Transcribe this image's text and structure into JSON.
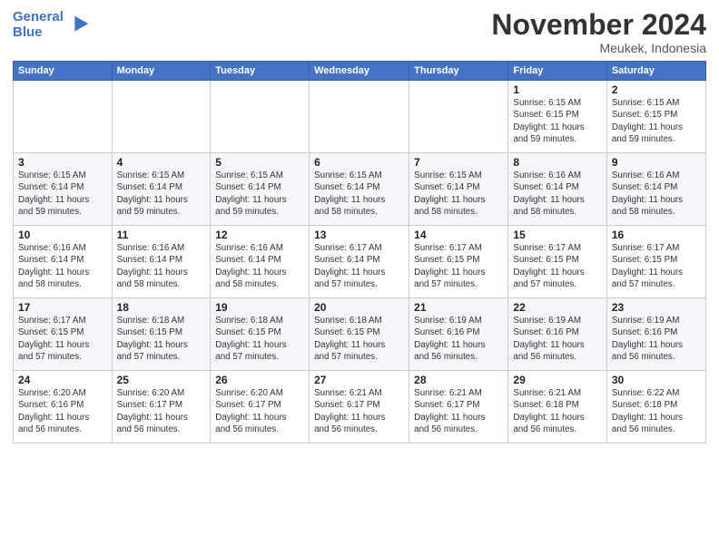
{
  "header": {
    "logo_line1": "General",
    "logo_line2": "Blue",
    "month": "November 2024",
    "location": "Meukek, Indonesia"
  },
  "weekdays": [
    "Sunday",
    "Monday",
    "Tuesday",
    "Wednesday",
    "Thursday",
    "Friday",
    "Saturday"
  ],
  "weeks": [
    [
      {
        "day": "",
        "info": ""
      },
      {
        "day": "",
        "info": ""
      },
      {
        "day": "",
        "info": ""
      },
      {
        "day": "",
        "info": ""
      },
      {
        "day": "",
        "info": ""
      },
      {
        "day": "1",
        "info": "Sunrise: 6:15 AM\nSunset: 6:15 PM\nDaylight: 11 hours\nand 59 minutes."
      },
      {
        "day": "2",
        "info": "Sunrise: 6:15 AM\nSunset: 6:15 PM\nDaylight: 11 hours\nand 59 minutes."
      }
    ],
    [
      {
        "day": "3",
        "info": "Sunrise: 6:15 AM\nSunset: 6:14 PM\nDaylight: 11 hours\nand 59 minutes."
      },
      {
        "day": "4",
        "info": "Sunrise: 6:15 AM\nSunset: 6:14 PM\nDaylight: 11 hours\nand 59 minutes."
      },
      {
        "day": "5",
        "info": "Sunrise: 6:15 AM\nSunset: 6:14 PM\nDaylight: 11 hours\nand 59 minutes."
      },
      {
        "day": "6",
        "info": "Sunrise: 6:15 AM\nSunset: 6:14 PM\nDaylight: 11 hours\nand 58 minutes."
      },
      {
        "day": "7",
        "info": "Sunrise: 6:15 AM\nSunset: 6:14 PM\nDaylight: 11 hours\nand 58 minutes."
      },
      {
        "day": "8",
        "info": "Sunrise: 6:16 AM\nSunset: 6:14 PM\nDaylight: 11 hours\nand 58 minutes."
      },
      {
        "day": "9",
        "info": "Sunrise: 6:16 AM\nSunset: 6:14 PM\nDaylight: 11 hours\nand 58 minutes."
      }
    ],
    [
      {
        "day": "10",
        "info": "Sunrise: 6:16 AM\nSunset: 6:14 PM\nDaylight: 11 hours\nand 58 minutes."
      },
      {
        "day": "11",
        "info": "Sunrise: 6:16 AM\nSunset: 6:14 PM\nDaylight: 11 hours\nand 58 minutes."
      },
      {
        "day": "12",
        "info": "Sunrise: 6:16 AM\nSunset: 6:14 PM\nDaylight: 11 hours\nand 58 minutes."
      },
      {
        "day": "13",
        "info": "Sunrise: 6:17 AM\nSunset: 6:14 PM\nDaylight: 11 hours\nand 57 minutes."
      },
      {
        "day": "14",
        "info": "Sunrise: 6:17 AM\nSunset: 6:15 PM\nDaylight: 11 hours\nand 57 minutes."
      },
      {
        "day": "15",
        "info": "Sunrise: 6:17 AM\nSunset: 6:15 PM\nDaylight: 11 hours\nand 57 minutes."
      },
      {
        "day": "16",
        "info": "Sunrise: 6:17 AM\nSunset: 6:15 PM\nDaylight: 11 hours\nand 57 minutes."
      }
    ],
    [
      {
        "day": "17",
        "info": "Sunrise: 6:17 AM\nSunset: 6:15 PM\nDaylight: 11 hours\nand 57 minutes."
      },
      {
        "day": "18",
        "info": "Sunrise: 6:18 AM\nSunset: 6:15 PM\nDaylight: 11 hours\nand 57 minutes."
      },
      {
        "day": "19",
        "info": "Sunrise: 6:18 AM\nSunset: 6:15 PM\nDaylight: 11 hours\nand 57 minutes."
      },
      {
        "day": "20",
        "info": "Sunrise: 6:18 AM\nSunset: 6:15 PM\nDaylight: 11 hours\nand 57 minutes."
      },
      {
        "day": "21",
        "info": "Sunrise: 6:19 AM\nSunset: 6:16 PM\nDaylight: 11 hours\nand 56 minutes."
      },
      {
        "day": "22",
        "info": "Sunrise: 6:19 AM\nSunset: 6:16 PM\nDaylight: 11 hours\nand 56 minutes."
      },
      {
        "day": "23",
        "info": "Sunrise: 6:19 AM\nSunset: 6:16 PM\nDaylight: 11 hours\nand 56 minutes."
      }
    ],
    [
      {
        "day": "24",
        "info": "Sunrise: 6:20 AM\nSunset: 6:16 PM\nDaylight: 11 hours\nand 56 minutes."
      },
      {
        "day": "25",
        "info": "Sunrise: 6:20 AM\nSunset: 6:17 PM\nDaylight: 11 hours\nand 56 minutes."
      },
      {
        "day": "26",
        "info": "Sunrise: 6:20 AM\nSunset: 6:17 PM\nDaylight: 11 hours\nand 56 minutes."
      },
      {
        "day": "27",
        "info": "Sunrise: 6:21 AM\nSunset: 6:17 PM\nDaylight: 11 hours\nand 56 minutes."
      },
      {
        "day": "28",
        "info": "Sunrise: 6:21 AM\nSunset: 6:17 PM\nDaylight: 11 hours\nand 56 minutes."
      },
      {
        "day": "29",
        "info": "Sunrise: 6:21 AM\nSunset: 6:18 PM\nDaylight: 11 hours\nand 56 minutes."
      },
      {
        "day": "30",
        "info": "Sunrise: 6:22 AM\nSunset: 6:18 PM\nDaylight: 11 hours\nand 56 minutes."
      }
    ]
  ]
}
